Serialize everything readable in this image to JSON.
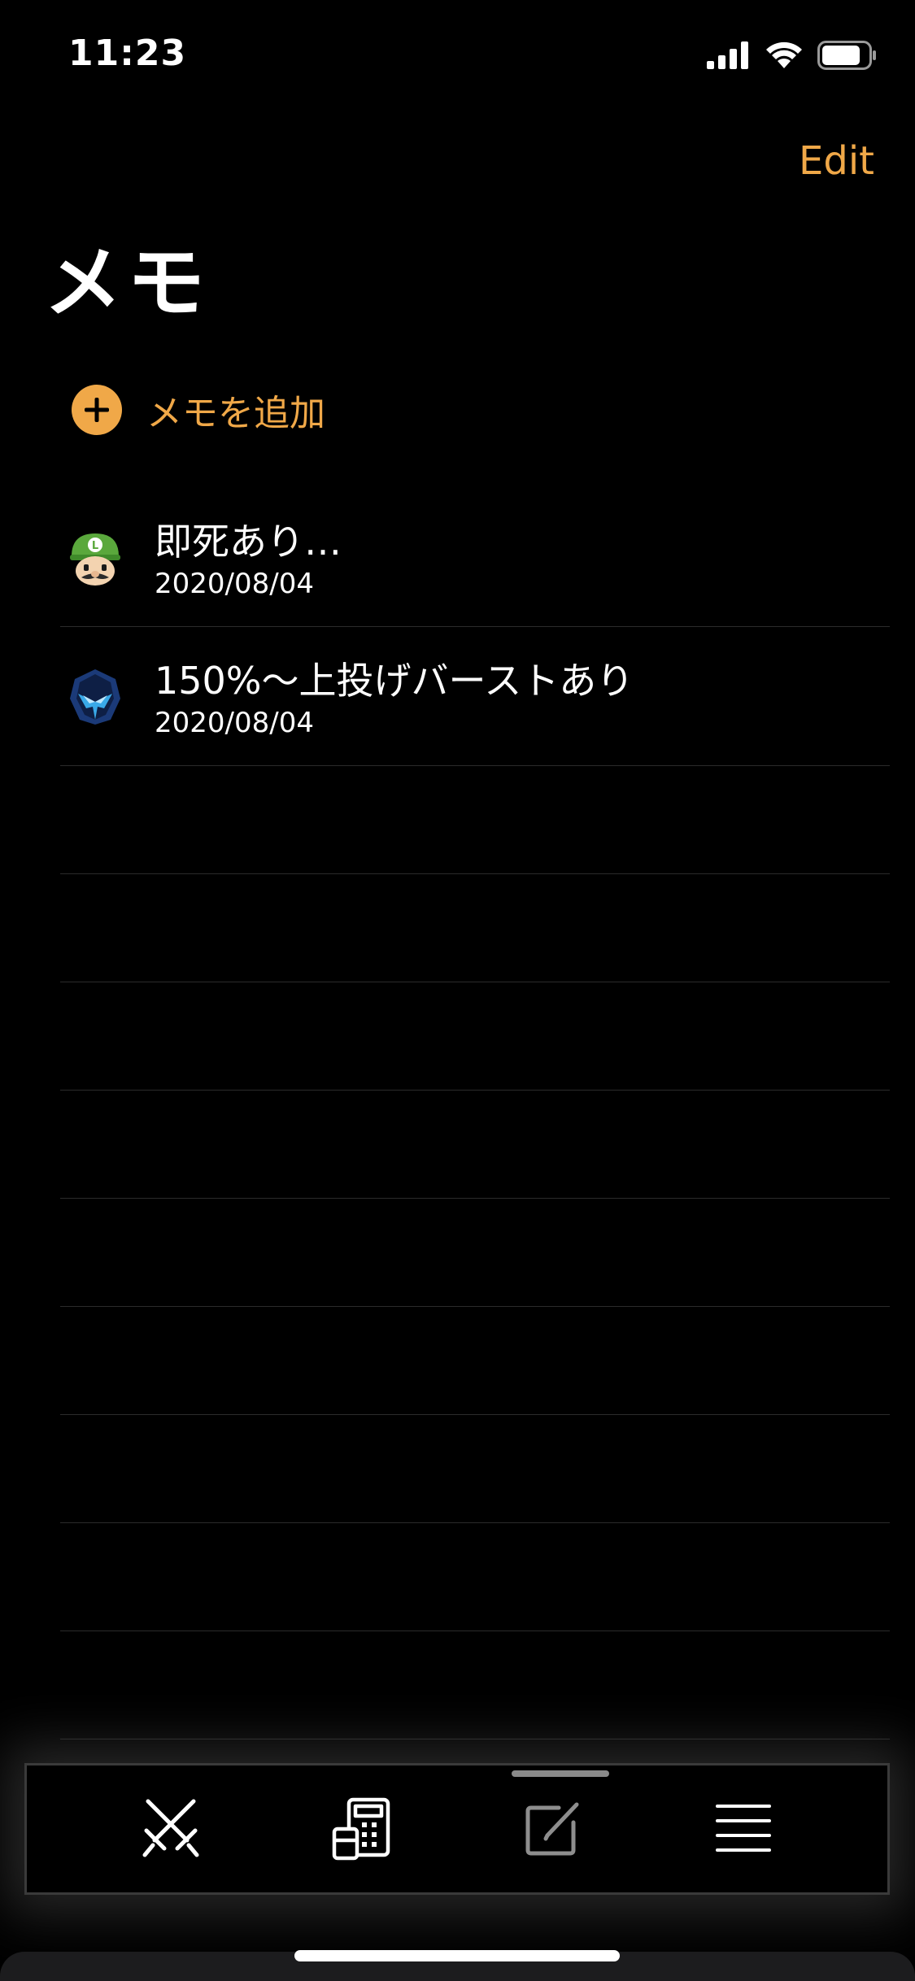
{
  "status_bar": {
    "time": "11:23"
  },
  "header": {
    "edit_label": "Edit",
    "title": "メモ"
  },
  "add_memo": {
    "label": "メモを追加"
  },
  "memos": [
    {
      "title": "即死あり…",
      "date": "2020/08/04",
      "avatar_icon": "luigi-icon"
    },
    {
      "title": "150%〜上投げバーストあり",
      "date": "2020/08/04",
      "avatar_icon": "dark-samus-icon"
    }
  ],
  "tab_bar": {
    "items": [
      {
        "icon": "crossed-swords-icon",
        "active": true
      },
      {
        "icon": "calculator-icon",
        "active": true
      },
      {
        "icon": "compose-icon",
        "active": false
      },
      {
        "icon": "menu-icon",
        "active": true
      }
    ]
  },
  "colors": {
    "accent": "#f0a848",
    "background": "#000000",
    "separator": "#2b2b2b"
  }
}
